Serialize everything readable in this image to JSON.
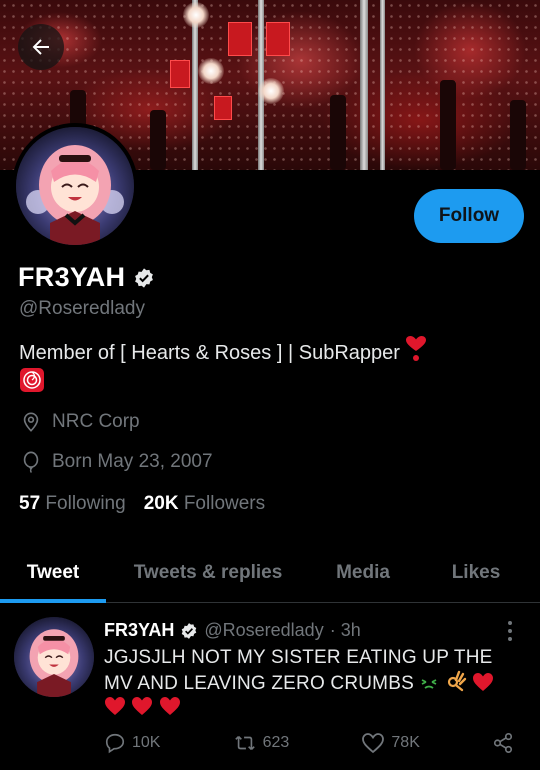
{
  "profile": {
    "display_name": "FR3YAH",
    "handle": "@Roseredlady",
    "bio_text": "Member of [ Hearts & Roses ] | SubRapper",
    "location": "NRC Corp",
    "birthday": "Born May 23, 2007",
    "following_count": "57",
    "following_label": "Following",
    "followers_count": "20K",
    "followers_label": "Followers",
    "verified_icon": "verified-badge-icon"
  },
  "header": {
    "back_icon": "arrow-left-icon",
    "follow_label": "Follow"
  },
  "tabs": [
    {
      "label": "Tweet",
      "active": true
    },
    {
      "label": "Tweets & replies",
      "active": false
    },
    {
      "label": "Media",
      "active": false
    },
    {
      "label": "Likes",
      "active": false
    }
  ],
  "tweet": {
    "author_name": "FR3YAH",
    "author_handle": "@Roseredlady",
    "time": "· 3h",
    "text": "JGJSJLH NOT MY SISTER EATING UP THE MV AND LEAVING ZERO CRUMBS",
    "replies": "10K",
    "retweets": "623",
    "likes": "78K"
  },
  "colors": {
    "accent": "#1d9bf0",
    "muted": "#71767b",
    "heart": "#e0172c"
  }
}
